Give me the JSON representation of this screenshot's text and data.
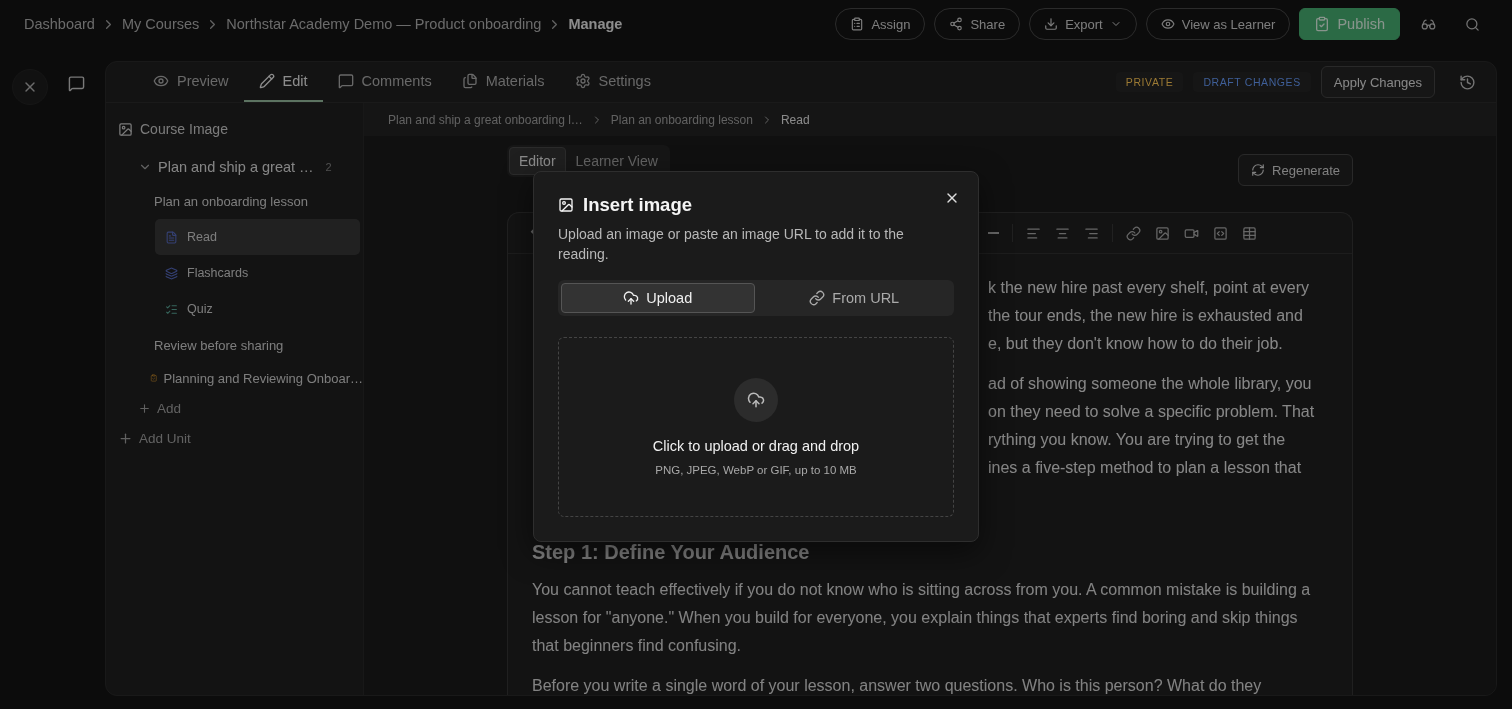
{
  "breadcrumbs": [
    {
      "label": "Dashboard",
      "current": false
    },
    {
      "label": "My Courses",
      "current": false
    },
    {
      "label": "Northstar Academy Demo — Product onboarding",
      "current": false
    },
    {
      "label": "Manage",
      "current": true
    }
  ],
  "header_actions": [
    {
      "label": "Assign",
      "kind": "outline"
    },
    {
      "label": "Share",
      "kind": "outline"
    },
    {
      "label": "Export",
      "kind": "dropdown"
    },
    {
      "label": "View as Learner",
      "kind": "outline"
    },
    {
      "label": "Publish",
      "kind": "primary"
    }
  ],
  "tabs": [
    {
      "label": "Preview",
      "selected": false
    },
    {
      "label": "Edit",
      "selected": true
    },
    {
      "label": "Comments",
      "selected": false
    },
    {
      "label": "Materials",
      "selected": false
    },
    {
      "label": "Settings",
      "selected": false
    }
  ],
  "badges": [
    {
      "label": "PRIVATE",
      "color": "#9c7a34"
    },
    {
      "label": "DRAFT CHANGES",
      "color": "#3f5f99"
    }
  ],
  "apply_button": "Apply Changes",
  "sidebar": {
    "course_image": "Course Image",
    "units": [
      {
        "title": "Plan and ship a great …",
        "count": "2",
        "expanded": true,
        "children": [
          {
            "title": "Plan an onboarding lesson",
            "kind": "lesson",
            "children": [
              {
                "title": "Read",
                "kind": "reading",
                "selected": true
              },
              {
                "title": "Flashcards",
                "kind": "flashcards",
                "selected": false
              },
              {
                "title": "Quiz",
                "kind": "quiz",
                "selected": false
              }
            ]
          },
          {
            "title": "Review before sharing",
            "kind": "lesson"
          },
          {
            "title": "Planning and Reviewing Onboar…",
            "kind": "assessment"
          }
        ],
        "add_label": "Add"
      }
    ],
    "add_unit": "Add Unit"
  },
  "content_breadcrumbs": [
    {
      "label": "Plan and ship a great onboarding l…",
      "current": false
    },
    {
      "label": "Plan an onboarding lesson",
      "current": false
    },
    {
      "label": "Read",
      "current": true
    }
  ],
  "editor": {
    "view_tabs": [
      {
        "label": "Editor",
        "selected": true
      },
      {
        "label": "Learner View",
        "selected": false
      }
    ],
    "regenerate": "Regenerate",
    "intro_paragraphs": [
      [
        "k the new hire past every shelf, point at every",
        "the tour ends, the new hire is exhausted and",
        "e, but they don't know how to do their job."
      ],
      [
        "ad of showing someone the whole library, you",
        "on they need to solve a specific problem. That",
        "rything you know. You are trying to get the",
        "ines a five-step method to plan a lesson that"
      ]
    ],
    "heading": "Step 1: Define Your Audience",
    "paragraphs": [
      "You cannot teach effectively if you do not know who is sitting across from you. A common mistake is building a lesson for \"anyone.\" When you build for everyone, you explain things that experts find boring and skip things that beginners find confusing.",
      "Before you write a single word of your lesson, answer two questions. Who is this person? What do they"
    ]
  },
  "modal": {
    "title": "Insert image",
    "description": "Upload an image or paste an image URL to add it to the reading.",
    "tabs": [
      {
        "label": "Upload",
        "selected": true
      },
      {
        "label": "From URL",
        "selected": false
      }
    ],
    "dropzone_title": "Click to upload or drag and drop",
    "dropzone_hint": "PNG, JPEG, WebP or GIF, up to 10 MB"
  }
}
